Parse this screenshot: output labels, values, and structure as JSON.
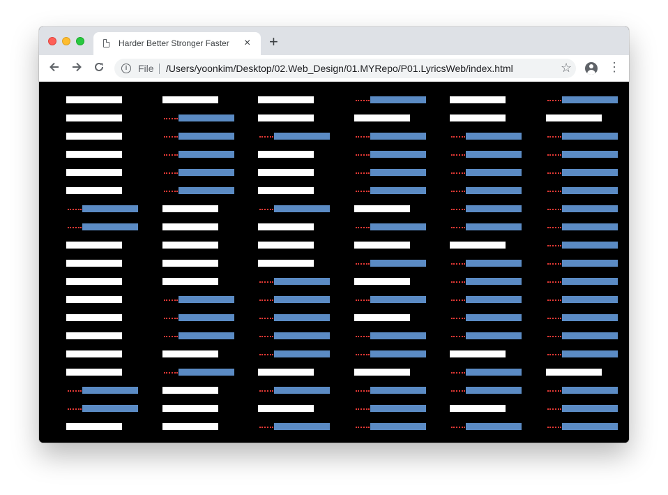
{
  "browser": {
    "tab_title": "Harder Better Stronger Faster",
    "tab_close": "×",
    "new_tab": "+",
    "scheme_label": "File",
    "url": "/Users/yoonkim/Desktop/02.Web_Design/01.MYRepo/P01.LyricsWeb/index.html",
    "icons": {
      "back": "arrow-left-icon",
      "forward": "arrow-right-icon",
      "reload": "reload-icon",
      "info": "info-icon",
      "star": "star-icon",
      "account": "account-icon",
      "menu": "more-vert-icon"
    }
  },
  "colors": {
    "background": "#000000",
    "bar_white": "#ffffff",
    "bar_blue": "#5b8bc4",
    "dots_red": "#e53935"
  },
  "grid": {
    "columns": 6,
    "rows": 19,
    "states": [
      [
        0,
        0,
        0,
        1,
        0,
        1
      ],
      [
        0,
        1,
        0,
        0,
        0,
        0
      ],
      [
        0,
        1,
        1,
        1,
        1,
        1
      ],
      [
        0,
        1,
        0,
        1,
        1,
        1
      ],
      [
        0,
        1,
        0,
        1,
        1,
        1
      ],
      [
        0,
        1,
        0,
        1,
        1,
        1
      ],
      [
        1,
        0,
        1,
        0,
        1,
        1
      ],
      [
        1,
        0,
        0,
        1,
        1,
        1
      ],
      [
        0,
        0,
        0,
        0,
        0,
        1
      ],
      [
        0,
        0,
        0,
        1,
        1,
        1
      ],
      [
        0,
        0,
        1,
        0,
        1,
        1
      ],
      [
        0,
        1,
        1,
        1,
        1,
        1
      ],
      [
        0,
        1,
        1,
        0,
        1,
        1
      ],
      [
        0,
        1,
        1,
        1,
        1,
        1
      ],
      [
        0,
        0,
        1,
        1,
        0,
        1
      ],
      [
        0,
        1,
        0,
        0,
        1,
        0
      ],
      [
        1,
        0,
        1,
        1,
        1,
        1
      ],
      [
        1,
        0,
        0,
        1,
        0,
        1
      ],
      [
        0,
        0,
        1,
        1,
        1,
        1
      ]
    ]
  }
}
